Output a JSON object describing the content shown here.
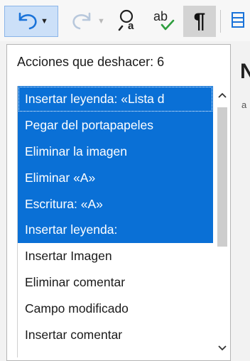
{
  "toolbar": {
    "undo_icon": "undo-icon",
    "redo_icon": "redo-icon",
    "find_replace_icon": "find-replace-icon",
    "spelling_icon": "spelling-icon",
    "formatting_marks_icon": "formatting-marks-icon",
    "spelling_label": "ab",
    "pilcrow_glyph": "¶"
  },
  "undo_popup": {
    "header": "Acciones que deshacer: 6",
    "selected_count": 6,
    "items": [
      {
        "label": "Insertar leyenda: «Lista d",
        "selected": true
      },
      {
        "label": "Pegar del portapapeles",
        "selected": true
      },
      {
        "label": "Eliminar la imagen",
        "selected": true
      },
      {
        "label": "Eliminar «A»",
        "selected": true
      },
      {
        "label": "Escritura: «A»",
        "selected": true
      },
      {
        "label": "Insertar leyenda:",
        "selected": true
      },
      {
        "label": "Insertar Imagen",
        "selected": false
      },
      {
        "label": "Eliminar comentar",
        "selected": false
      },
      {
        "label": "Campo modificado",
        "selected": false
      },
      {
        "label": "Insertar comentar",
        "selected": false
      }
    ]
  },
  "document": {
    "heading_fragment": "N",
    "char_fragment": "a",
    "edge_fragment": ";"
  },
  "colors": {
    "selection": "#0a70d6",
    "accent": "#1a73d9",
    "spell_check": "#2e9e3e"
  }
}
